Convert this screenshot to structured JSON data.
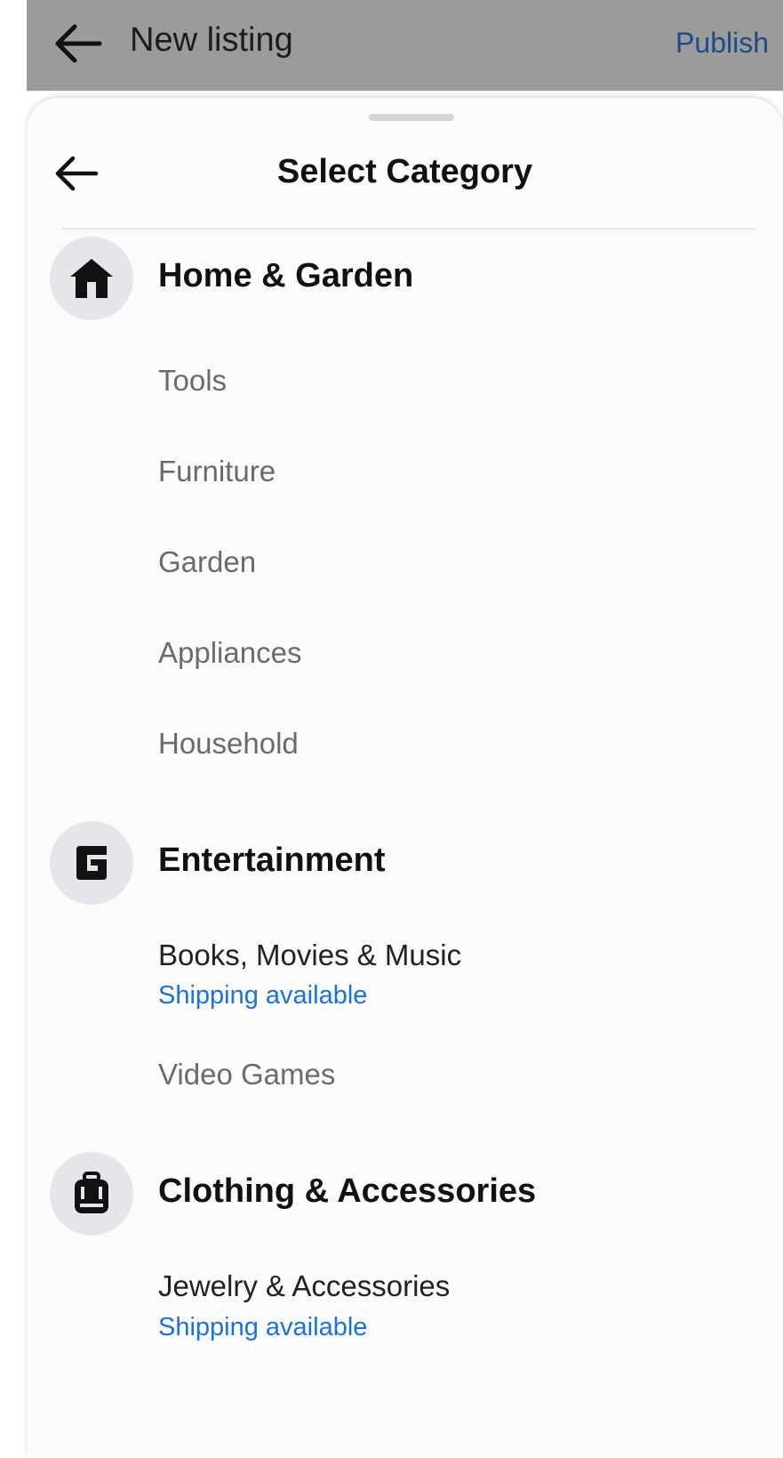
{
  "header": {
    "title": "New listing",
    "publish_label": "Publish"
  },
  "sheet": {
    "title": "Select Category"
  },
  "categories": [
    {
      "name": "Home & Garden",
      "icon": "home-icon",
      "items": [
        {
          "label": "Tools"
        },
        {
          "label": "Furniture"
        },
        {
          "label": "Garden"
        },
        {
          "label": "Appliances"
        },
        {
          "label": "Household"
        }
      ]
    },
    {
      "name": "Entertainment",
      "icon": "entertainment-icon",
      "items": [
        {
          "label": "Books, Movies & Music",
          "note": "Shipping available"
        },
        {
          "label": "Video Games"
        }
      ]
    },
    {
      "name": "Clothing & Accessories",
      "icon": "backpack-icon",
      "items": [
        {
          "label": "Jewelry & Accessories",
          "note": "Shipping available"
        }
      ]
    }
  ],
  "colors": {
    "header_bg": "#9b9b9b",
    "publish": "#1c4b8a",
    "shipping_note": "#1a73d9",
    "icon_circle": "#e4e6eb"
  }
}
